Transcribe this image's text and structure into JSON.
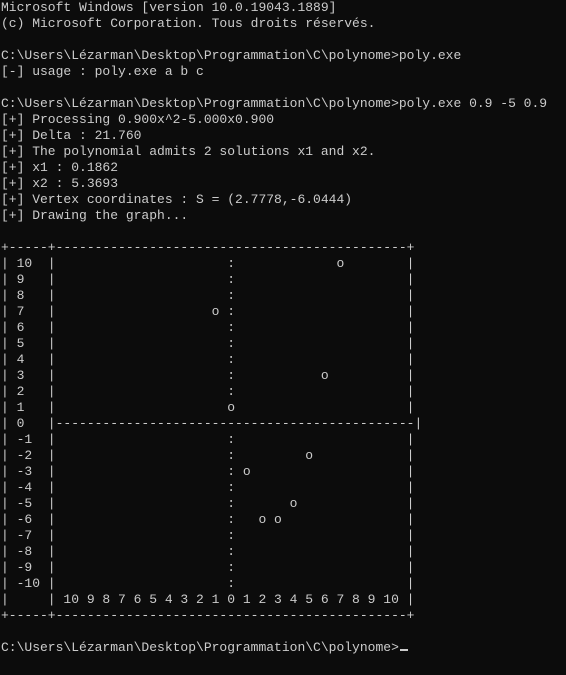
{
  "console": {
    "lines": [
      "Microsoft Windows [version 10.0.19043.1889]",
      "(c) Microsoft Corporation. Tous droits réservés.",
      "",
      "C:\\Users\\Lézarman\\Desktop\\Programmation\\C\\polynome>poly.exe",
      "[-] usage : poly.exe a b c",
      "",
      "C:\\Users\\Lézarman\\Desktop\\Programmation\\C\\polynome>poly.exe 0.9 -5 0.9",
      "[+] Processing 0.900x^2-5.000x0.900",
      "[+] Delta : 21.760",
      "[+] The polynomial admits 2 solutions x1 and x2.",
      "[+] x1 : 0.1862",
      "[+] x2 : 5.3693",
      "[+] Vertex coordinates : S = (2.7778,-6.0444)",
      "[+] Drawing the graph...",
      "",
      "+-----+---------------------------------------------+",
      "| 10  |                      :             o        |",
      "| 9   |                      :                      |",
      "| 8   |                      :                      |",
      "| 7   |                    o :                      |",
      "| 6   |                      :                      |",
      "| 5   |                      :                      |",
      "| 4   |                      :                      |",
      "| 3   |                      :           o          |",
      "| 2   |                      :                      |",
      "| 1   |                      o                      |",
      "| 0   |----------------------------------------------|",
      "| -1  |                      :                      |",
      "| -2  |                      :         o            |",
      "| -3  |                      : o                    |",
      "| -4  |                      :                      |",
      "| -5  |                      :       o              |",
      "| -6  |                      :   o o                |",
      "| -7  |                      :                      |",
      "| -8  |                      :                      |",
      "| -9  |                      :                      |",
      "| -10 |                      :                      |",
      "|     | 10 9 8 7 6 5 4 3 2 1 0 1 2 3 4 5 6 7 8 9 10 |",
      "+-----+---------------------------------------------+",
      "",
      "C:\\Users\\Lézarman\\Desktop\\Programmation\\C\\polynome>"
    ]
  }
}
